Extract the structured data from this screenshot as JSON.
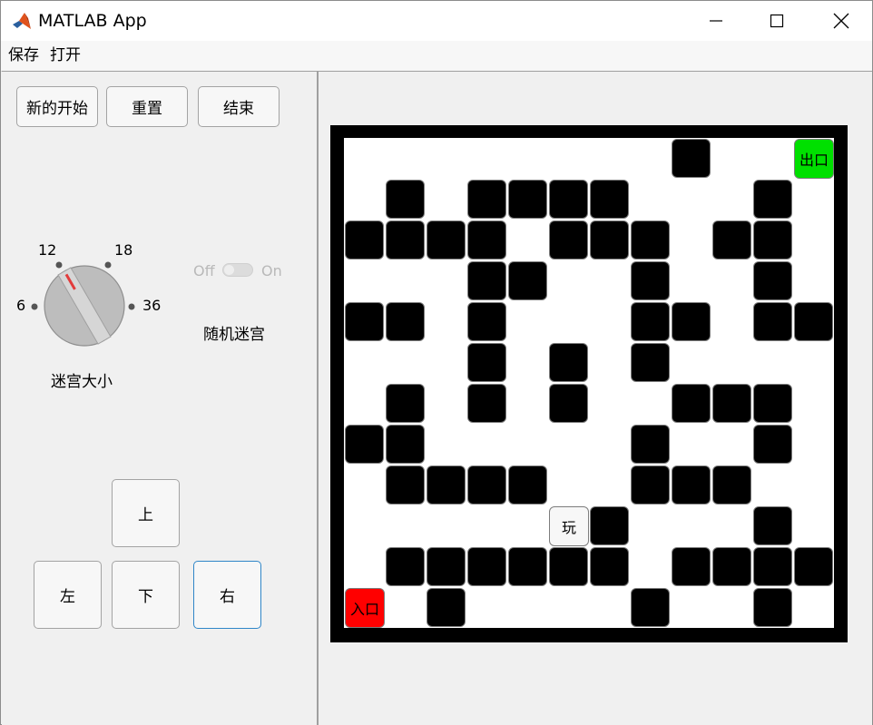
{
  "window": {
    "title": "MATLAB App"
  },
  "menu": {
    "save": "保存",
    "open": "打开"
  },
  "top_buttons": {
    "new_start": "新的开始",
    "reset": "重置",
    "end": "结束"
  },
  "knob": {
    "labels": [
      "6",
      "12",
      "18",
      "36"
    ],
    "caption": "迷宫大小",
    "selected": "12"
  },
  "switch": {
    "off_label": "Off",
    "on_label": "On",
    "caption": "随机迷宫",
    "state": "Off"
  },
  "direction_buttons": {
    "up": "上",
    "left": "左",
    "down": "下",
    "right": "右"
  },
  "maze": {
    "entrance_label": "入口",
    "exit_label": "出口",
    "player_label": "玩",
    "colors": {
      "entrance": "#ff0000",
      "exit": "#00e000",
      "wall": "#000000",
      "background": "#ffffff"
    },
    "grid_size": 12,
    "grid": [
      "00000000W00X",
      "0W0WWWW000W0",
      "WWWW0WWW0WW0",
      "000WW00W00W0",
      "WW0W000WW0WW",
      "000W0W0W0000",
      "0W0W0W00WWW0",
      "WW00000W00W0",
      "0WWWW00WWW00",
      "00000PW000W0",
      "0WWWWWW0WWWW",
      "E0W0000W00W0"
    ]
  }
}
